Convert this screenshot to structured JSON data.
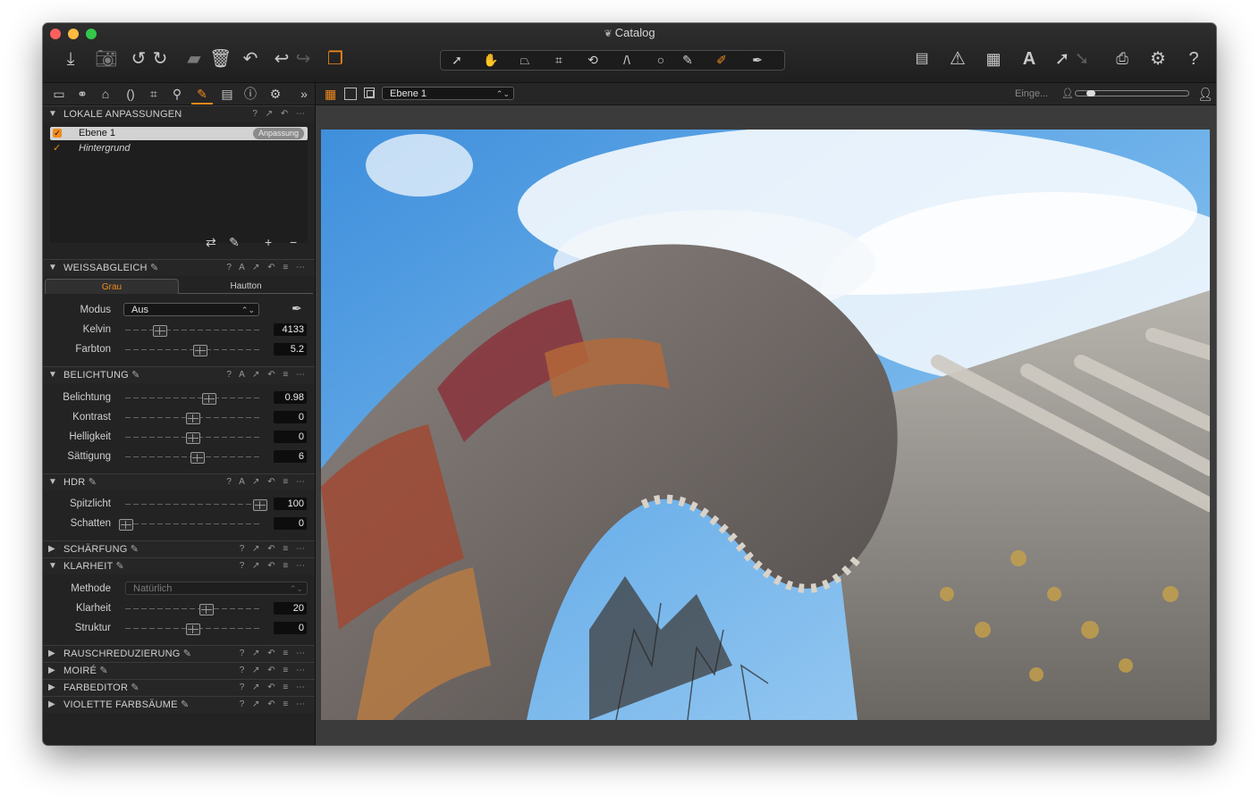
{
  "window": {
    "title": "Catalog"
  },
  "colors": {
    "accent": "#f08a1d",
    "panel": "#232323",
    "viewer_bg": "#3b3b3b",
    "sky": "#5aa2e0"
  },
  "toolbar": {
    "left_icons": [
      "import-icon",
      "camera-icon",
      "rotate-left-icon",
      "rotate-right-icon",
      "folder-icon",
      "trash-icon",
      "reset-icon",
      "undo-icon",
      "redo-icon",
      "variants-icon"
    ],
    "tool_icons": [
      "select-icon",
      "pan-icon",
      "keystone-icon",
      "crop-icon",
      "rotate-icon",
      "straighten-icon",
      "circle-icon",
      "brush-icon",
      "erase-icon",
      "pick-icon"
    ],
    "right_icons": [
      "layout-icon",
      "warning-icon",
      "grid-icon",
      "text-icon",
      "export-icon",
      "print-icon",
      "gear-icon",
      "help-icon"
    ]
  },
  "left_tabs": [
    "library-icon",
    "color-icon",
    "exposure-icon",
    "lens-icon",
    "crop-icon",
    "detail-icon",
    "adjust-icon",
    "metadata-icon",
    "output-icon",
    "settings-icon",
    "more-icon"
  ],
  "local": {
    "title": "LOKALE ANPASSUNGEN",
    "layers": [
      {
        "name": "Ebene 1",
        "badge": "Anpassung",
        "checked": true
      },
      {
        "name": "Hintergrund",
        "checked": true
      }
    ]
  },
  "white_balance": {
    "title": "WEISSABGLEICH",
    "tabs": [
      "Grau",
      "Hautton"
    ],
    "modus_label": "Modus",
    "modus_value": "Aus",
    "kelvin_label": "Kelvin",
    "kelvin_value": "4133",
    "kelvin_level": 0.25,
    "farbton_label": "Farbton",
    "farbton_value": "5.2",
    "farbton_level": 0.55
  },
  "exposure": {
    "title": "BELICHTUNG",
    "rows": [
      {
        "label": "Belichtung",
        "value": "0.98",
        "level": 0.62
      },
      {
        "label": "Kontrast",
        "value": "0",
        "level": 0.5
      },
      {
        "label": "Helligkeit",
        "value": "0",
        "level": 0.5
      },
      {
        "label": "Sättigung",
        "value": "6",
        "level": 0.53
      }
    ]
  },
  "hdr": {
    "title": "HDR",
    "rows": [
      {
        "label": "Spitzlicht",
        "value": "100",
        "level": 1.0
      },
      {
        "label": "Schatten",
        "value": "0",
        "level": 0.0
      }
    ]
  },
  "sharpening": {
    "title": "SCHÄRFUNG"
  },
  "clarity": {
    "title": "KLARHEIT",
    "method_label": "Methode",
    "method_value": "Natürlich",
    "rows": [
      {
        "label": "Klarheit",
        "value": "20",
        "level": 0.6
      },
      {
        "label": "Struktur",
        "value": "0",
        "level": 0.5
      }
    ]
  },
  "collapsed_sections": [
    "RAUSCHREDUZIERUNG",
    "MOIRÉ",
    "FARBEDITOR",
    "VIOLETTE FARBSÄUME"
  ],
  "viewer": {
    "layer_select": "Ebene 1",
    "zoom_label": "Einge...",
    "zoom_level": 0.1
  }
}
